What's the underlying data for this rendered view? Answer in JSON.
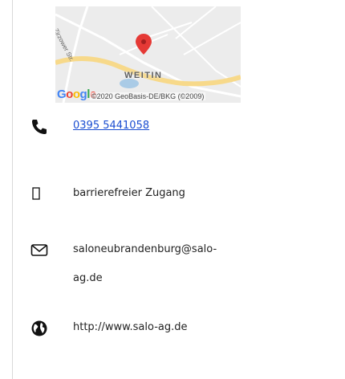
{
  "map": {
    "town_label": "WEITIN",
    "street_label": "Zirzower Str.",
    "logo_text": "Google",
    "copyright": "©2020 GeoBasis-DE/BKG (©2009)",
    "colors": {
      "background": "#ececec",
      "road_major": "#f7d98a",
      "marker": "#e53935",
      "water": "#aacbe6"
    }
  },
  "contact": {
    "phone": "0395 5441058",
    "accessibility": "barrierefreier Zugang",
    "email_line1": "saloneubrandenburg@salo-",
    "email_line2": "ag.de",
    "website": "http://www.salo-ag.de"
  },
  "icons": [
    "phone-icon",
    "accessibility-icon",
    "mail-icon",
    "globe-icon"
  ]
}
